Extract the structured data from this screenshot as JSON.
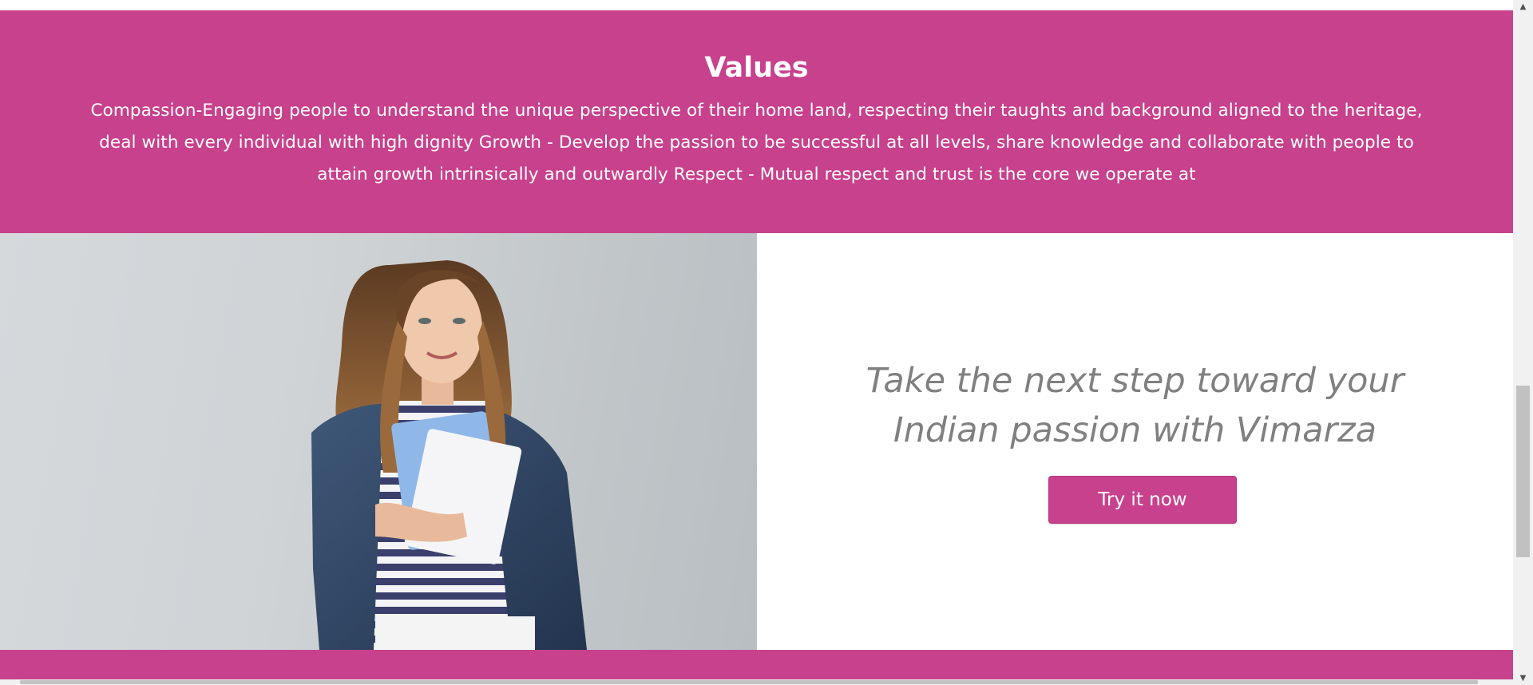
{
  "values": {
    "title": "Values",
    "text": "Compassion-Engaging people to understand the unique perspective of their home land, respecting their taughts and background aligned to the heritage, deal with every individual with high dignity Growth - Develop the passion to be successful at all levels, share knowledge and collaborate with people to attain growth intrinsically and outwardly Respect - Mutual respect and trust is the core we operate at"
  },
  "cta": {
    "heading_line1": "Take the next step toward your",
    "heading_line2": "Indian passion with Vimarza",
    "button_label": "Try it now",
    "image_alt": "student-with-books-photo"
  },
  "colors": {
    "brand": "#c8418c",
    "heading_text": "#808080",
    "white": "#ffffff"
  },
  "icons": {
    "scroll_up": "▲",
    "scroll_down": "▼"
  }
}
